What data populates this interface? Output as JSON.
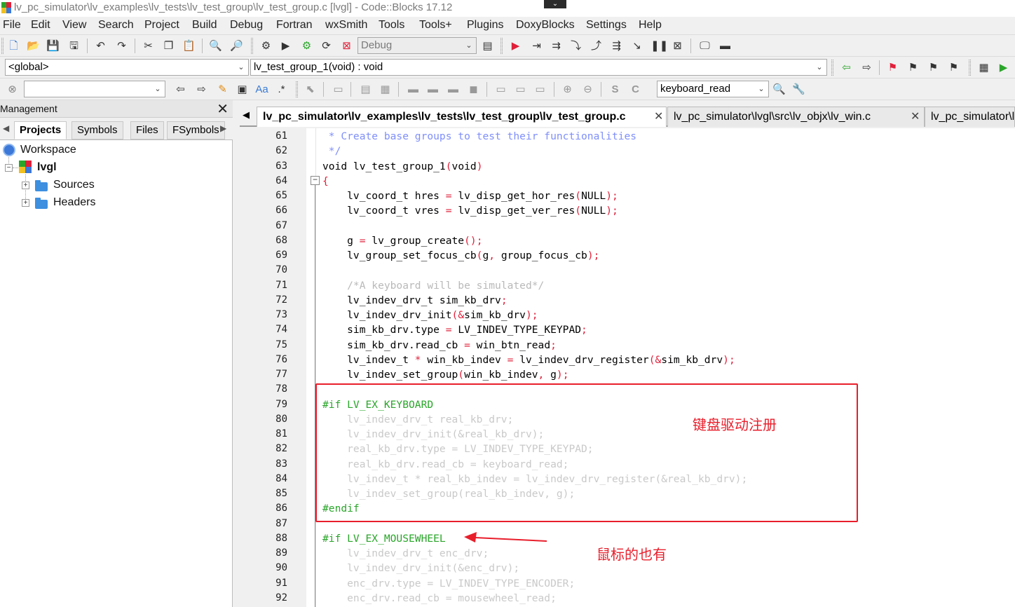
{
  "window": {
    "title": "lv_pc_simulator\\lv_examples\\lv_tests\\lv_test_group\\lv_test_group.c [lvgl] - Code::Blocks 17.12"
  },
  "menu": [
    "File",
    "Edit",
    "View",
    "Search",
    "Project",
    "Build",
    "Debug",
    "Fortran",
    "wxSmith",
    "Tools",
    "Tools+",
    "Plugins",
    "DoxyBlocks",
    "Settings",
    "Help"
  ],
  "toolbar": {
    "build_target": "Debug",
    "scope": "<global>",
    "function": "lv_test_group_1(void) : void",
    "search_value": "",
    "symbol_search": "keyboard_read"
  },
  "management": {
    "title": "Management",
    "close_label": "✕",
    "tabs": [
      "Projects",
      "Symbols",
      "Files",
      "FSymbols"
    ],
    "active_tab": "Projects",
    "tree": {
      "workspace": "Workspace",
      "project": "lvgl",
      "folders": [
        "Sources",
        "Headers"
      ]
    }
  },
  "editor": {
    "tabs": [
      {
        "label": "lv_pc_simulator\\lv_examples\\lv_tests\\lv_test_group\\lv_test_group.c",
        "active": true
      },
      {
        "label": "lv_pc_simulator\\lvgl\\src\\lv_objx\\lv_win.c",
        "active": false
      },
      {
        "label": "lv_pc_simulator\\lv",
        "active": false
      }
    ],
    "lines": [
      {
        "n": "61",
        "t": " * Create base groups to test their functionalities",
        "k": "comment"
      },
      {
        "n": "62",
        "t": " */",
        "k": "comment"
      },
      {
        "n": "63",
        "t": "void lv_test_group_1(void)",
        "k": "code"
      },
      {
        "n": "64",
        "t": "{",
        "k": "code"
      },
      {
        "n": "65",
        "t": "    lv_coord_t hres = lv_disp_get_hor_res(NULL);",
        "k": "code"
      },
      {
        "n": "66",
        "t": "    lv_coord_t vres = lv_disp_get_ver_res(NULL);",
        "k": "code"
      },
      {
        "n": "67",
        "t": "",
        "k": "code"
      },
      {
        "n": "68",
        "t": "    g = lv_group_create();",
        "k": "code"
      },
      {
        "n": "69",
        "t": "    lv_group_set_focus_cb(g, group_focus_cb);",
        "k": "code"
      },
      {
        "n": "70",
        "t": "",
        "k": "code"
      },
      {
        "n": "71",
        "t": "    /*A keyboard will be simulated*/",
        "k": "ccomment"
      },
      {
        "n": "72",
        "t": "    lv_indev_drv_t sim_kb_drv;",
        "k": "code"
      },
      {
        "n": "73",
        "t": "    lv_indev_drv_init(&sim_kb_drv);",
        "k": "code"
      },
      {
        "n": "74",
        "t": "    sim_kb_drv.type = LV_INDEV_TYPE_KEYPAD;",
        "k": "code"
      },
      {
        "n": "75",
        "t": "    sim_kb_drv.read_cb = win_btn_read;",
        "k": "code"
      },
      {
        "n": "76",
        "t": "    lv_indev_t * win_kb_indev = lv_indev_drv_register(&sim_kb_drv);",
        "k": "code"
      },
      {
        "n": "77",
        "t": "    lv_indev_set_group(win_kb_indev, g);",
        "k": "code"
      },
      {
        "n": "78",
        "t": "",
        "k": "code"
      },
      {
        "n": "79",
        "t": "#if LV_EX_KEYBOARD",
        "k": "pre"
      },
      {
        "n": "80",
        "t": "    lv_indev_drv_t real_kb_drv;",
        "k": "inactive"
      },
      {
        "n": "81",
        "t": "    lv_indev_drv_init(&real_kb_drv);",
        "k": "inactive"
      },
      {
        "n": "82",
        "t": "    real_kb_drv.type = LV_INDEV_TYPE_KEYPAD;",
        "k": "inactive"
      },
      {
        "n": "83",
        "t": "    real_kb_drv.read_cb = keyboard_read;",
        "k": "inactive"
      },
      {
        "n": "84",
        "t": "    lv_indev_t * real_kb_indev = lv_indev_drv_register(&real_kb_drv);",
        "k": "inactive"
      },
      {
        "n": "85",
        "t": "    lv_indev_set_group(real_kb_indev, g);",
        "k": "inactive"
      },
      {
        "n": "86",
        "t": "#endif",
        "k": "pre"
      },
      {
        "n": "87",
        "t": "",
        "k": "code"
      },
      {
        "n": "88",
        "t": "#if LV_EX_MOUSEWHEEL",
        "k": "pre"
      },
      {
        "n": "89",
        "t": "    lv_indev_drv_t enc_drv;",
        "k": "inactive"
      },
      {
        "n": "90",
        "t": "    lv_indev_drv_init(&enc_drv);",
        "k": "inactive"
      },
      {
        "n": "91",
        "t": "    enc_drv.type = LV_INDEV_TYPE_ENCODER;",
        "k": "inactive"
      },
      {
        "n": "92",
        "t": "    enc_drv.read_cb = mousewheel_read;",
        "k": "inactive"
      }
    ]
  },
  "annotations": {
    "keyboard_note": "键盘驱动注册",
    "mouse_note": "鼠标的也有",
    "color": "#e81e2b"
  },
  "colors": {
    "comment": "#7f8ffa",
    "preprocessor": "#2aa52a",
    "inactive": "#c9c9c9",
    "operator": "#e0203a"
  }
}
